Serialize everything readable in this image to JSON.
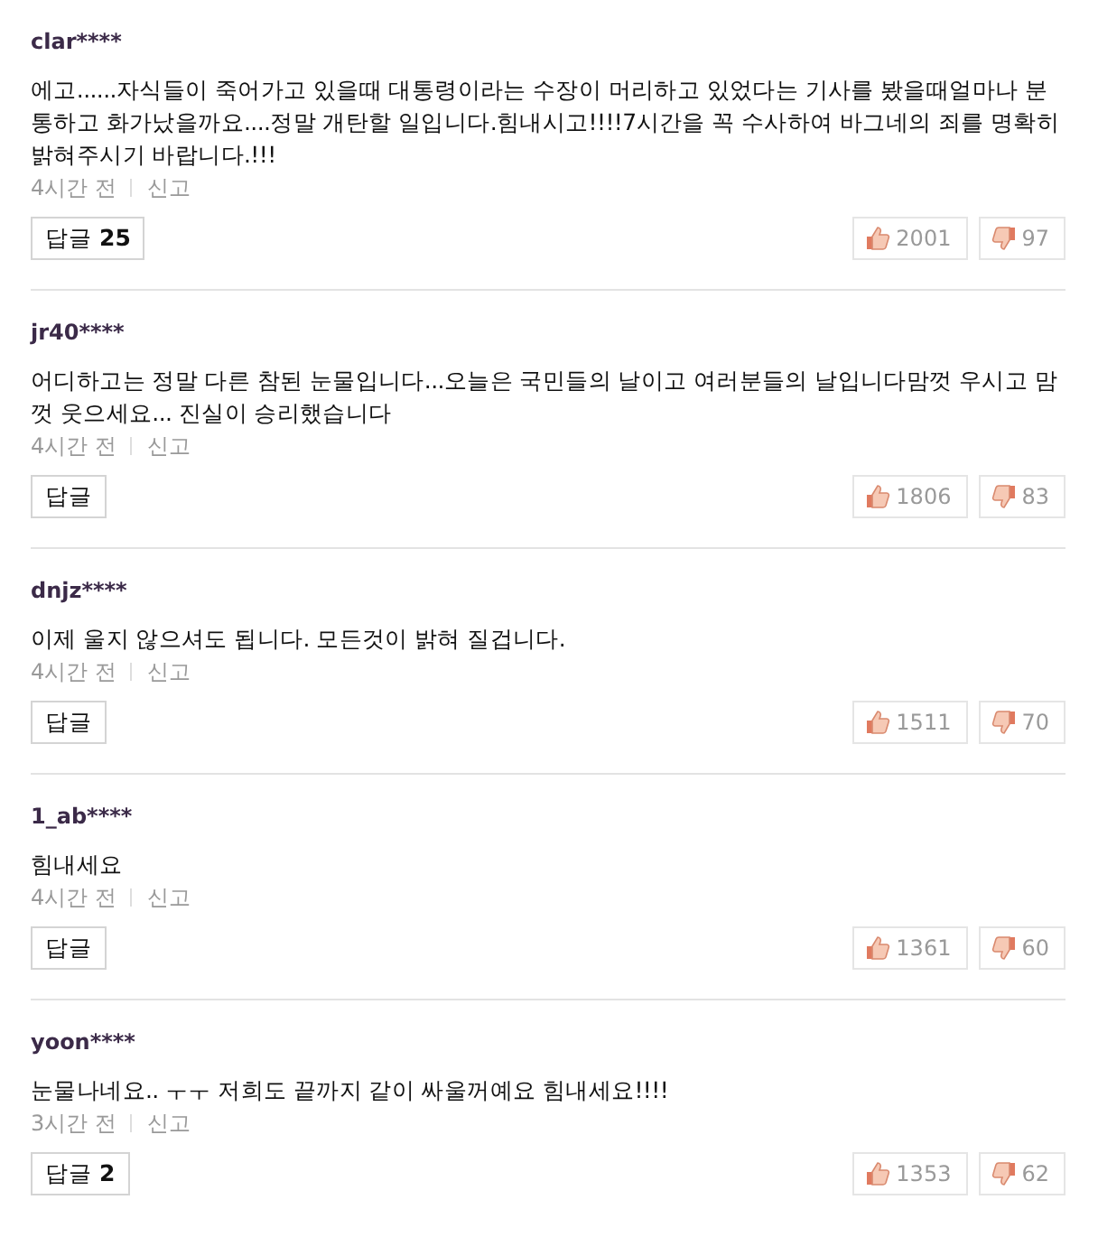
{
  "comments": [
    {
      "user": "clar****",
      "text": "에고......자식들이 죽어가고 있을때 대통령이라는 수장이 머리하고 있었다는 기사를 봤을때얼마나 분통하고 화가났을까요....정말 개탄할 일입니다.힘내시고!!!!7시간을 꼭 수사하여 바그네의 죄를 명확히 밝혀주시기 바랍니다.!!!",
      "time": "4시간 전",
      "report": "신고",
      "reply_label": "답글",
      "reply_count": "25",
      "likes": "2001",
      "dislikes": "97"
    },
    {
      "user": "jr40****",
      "text": "어디하고는 정말 다른 참된 눈물입니다...오늘은 국민들의 날이고 여러분들의 날입니다맘껏 우시고 맘껏 웃으세요... 진실이 승리했습니다",
      "time": "4시간 전",
      "report": "신고",
      "reply_label": "답글",
      "likes": "1806",
      "dislikes": "83"
    },
    {
      "user": "dnjz****",
      "text": "이제 울지 않으셔도 됩니다. 모든것이 밝혀 질겁니다.",
      "time": "4시간 전",
      "report": "신고",
      "reply_label": "답글",
      "likes": "1511",
      "dislikes": "70"
    },
    {
      "user": "1_ab****",
      "text": "힘내세요",
      "time": "4시간 전",
      "report": "신고",
      "reply_label": "답글",
      "likes": "1361",
      "dislikes": "60"
    },
    {
      "user": "yoon****",
      "text": "눈물나네요.. ㅜㅜ 저희도 끝까지 같이 싸울꺼예요 힘내세요!!!!",
      "time": "3시간 전",
      "report": "신고",
      "reply_label": "답글",
      "reply_count": "2",
      "likes": "1353",
      "dislikes": "62"
    }
  ]
}
